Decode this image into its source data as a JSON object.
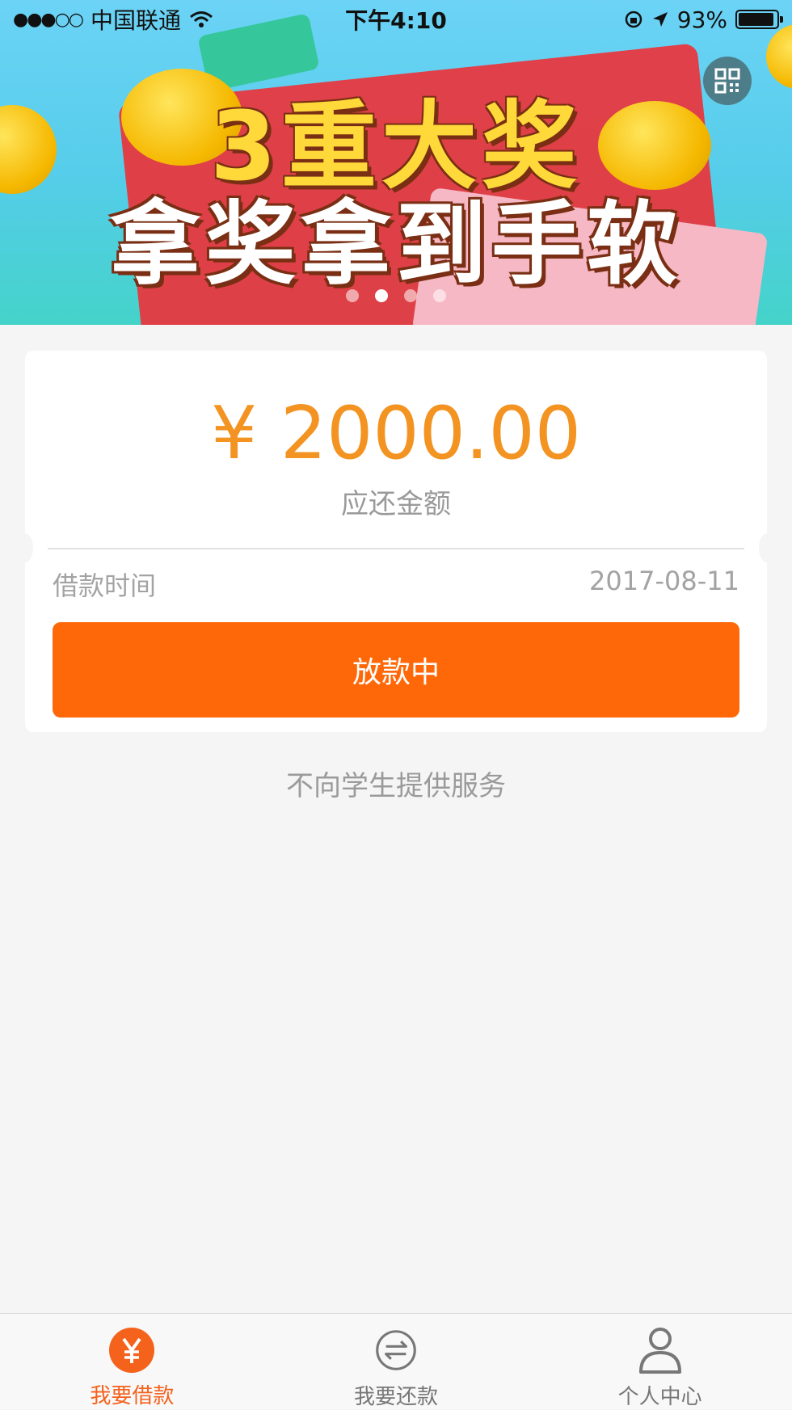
{
  "status_bar": {
    "carrier": "中国联通",
    "signal_dots": "●●●○○",
    "time": "下午4:10",
    "battery_percent": "93%",
    "battery_level": 0.93
  },
  "banner": {
    "headline_line1": "3重大奖",
    "headline_line2": "拿奖拿到手软",
    "carousel_total": 4,
    "carousel_active_index": 1
  },
  "loan_card": {
    "amount": "¥ 2000.00",
    "amount_label": "应还金额",
    "loan_time_label": "借款时间",
    "loan_date": "2017-08-11",
    "status_button_label": "放款中"
  },
  "notice_text": "不向学生提供服务",
  "tabbar": {
    "tabs": [
      {
        "label": "我要借款",
        "icon": "yen-coin-icon",
        "active": true
      },
      {
        "label": "我要还款",
        "icon": "exchange-icon",
        "active": false
      },
      {
        "label": "个人中心",
        "icon": "user-icon",
        "active": false
      }
    ]
  },
  "colors": {
    "accent_orange": "#ff6809",
    "amount_orange": "#f39321",
    "tab_active": "#f4621c"
  }
}
